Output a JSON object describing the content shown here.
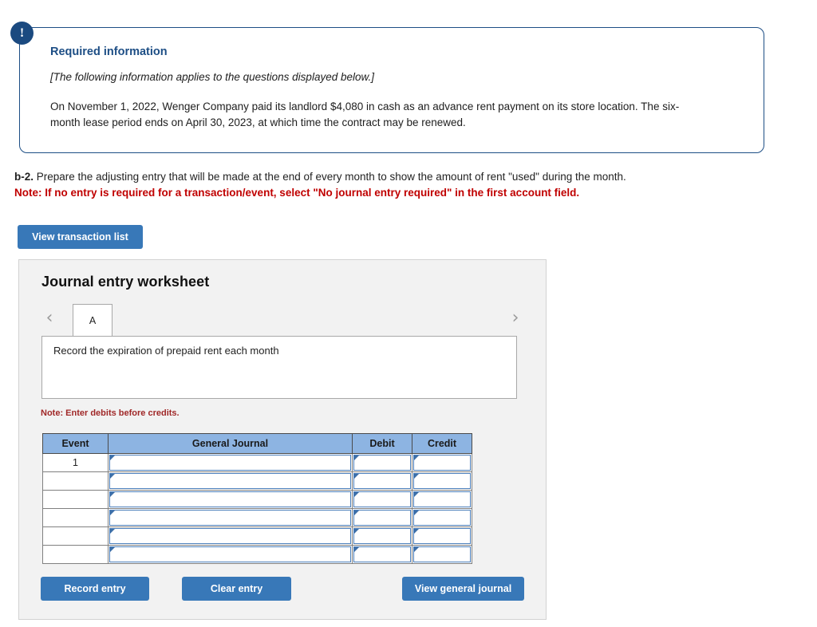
{
  "required_info": {
    "badge": "!",
    "title": "Required information",
    "subtitle": "[The following information applies to the questions displayed below.]",
    "body": "On November 1, 2022, Wenger Company paid its landlord $4,080 in cash as an advance rent payment on its store location. The six-month lease period ends on April 30, 2023, at which time the contract may be renewed."
  },
  "question": {
    "label": "b-2.",
    "text": " Prepare the adjusting entry that will be made at the end of every month to show the amount of rent \"used\" during the month.",
    "note": "Note: If no entry is required for a transaction/event, select \"No journal entry required\" in the first account field."
  },
  "toolbar": {
    "view_transaction_list_label": "View transaction list"
  },
  "worksheet": {
    "title": "Journal entry worksheet",
    "prev_chevron": "‹",
    "next_chevron": "›",
    "tabs": [
      {
        "label": "A",
        "selected": true
      }
    ],
    "description": "Record the expiration of prepaid rent each month",
    "debits_note": "Note: Enter debits before credits.",
    "table": {
      "columns": [
        "Event",
        "General Journal",
        "Debit",
        "Credit"
      ],
      "rows": [
        {
          "event": "1",
          "general_journal": "",
          "debit": "",
          "credit": ""
        },
        {
          "event": "",
          "general_journal": "",
          "debit": "",
          "credit": ""
        },
        {
          "event": "",
          "general_journal": "",
          "debit": "",
          "credit": ""
        },
        {
          "event": "",
          "general_journal": "",
          "debit": "",
          "credit": ""
        },
        {
          "event": "",
          "general_journal": "",
          "debit": "",
          "credit": ""
        },
        {
          "event": "",
          "general_journal": "",
          "debit": "",
          "credit": ""
        }
      ]
    },
    "actions": {
      "record_entry_label": "Record entry",
      "clear_entry_label": "Clear entry",
      "view_general_journal_label": "View general journal"
    }
  },
  "colors": {
    "accent_blue": "#3878b8",
    "callout_border": "#1d4e85",
    "badge_navy": "#1b4a80",
    "note_red": "#c00000",
    "table_header_blue": "#8db4e2",
    "field_border_blue": "#4a7ebb",
    "panel_gray": "#f2f2f2"
  }
}
